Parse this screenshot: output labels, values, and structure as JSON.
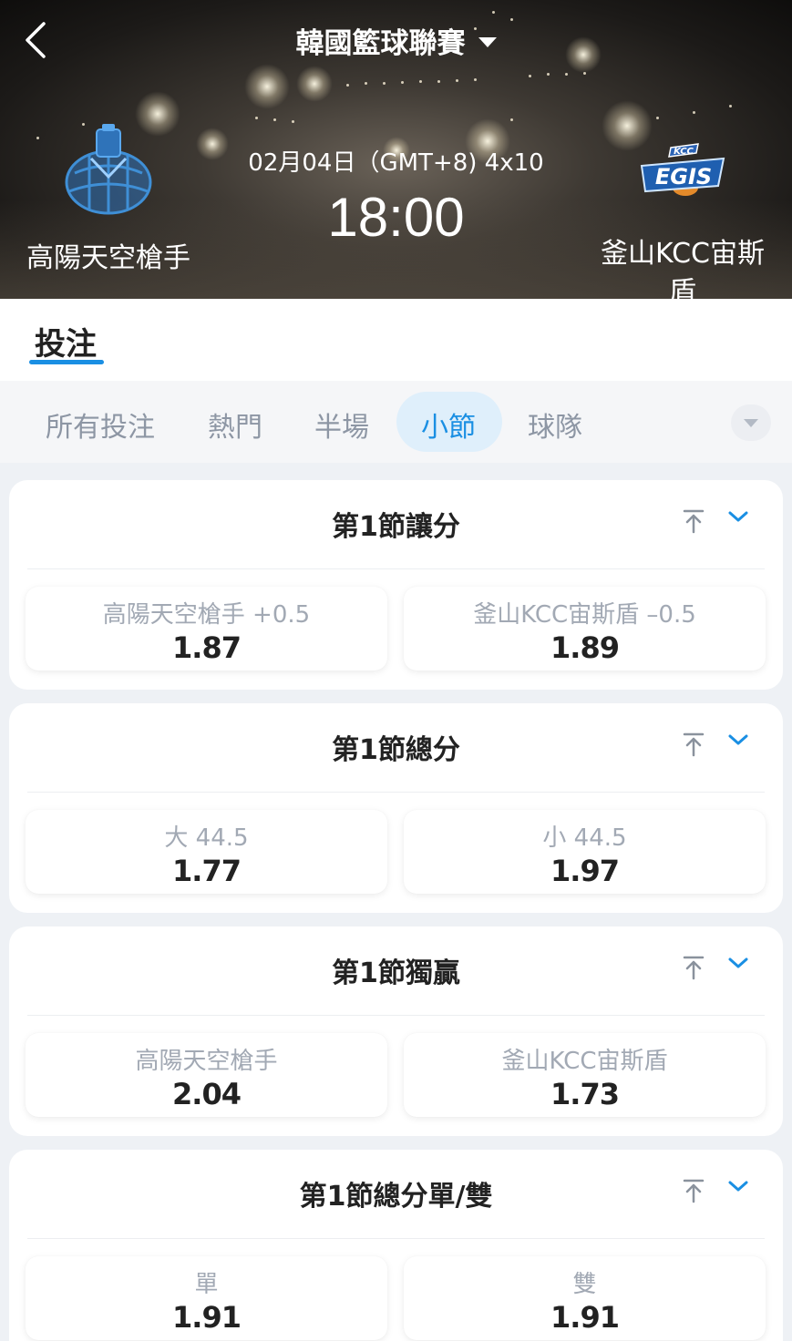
{
  "header": {
    "league_title": "韓國籃球聯賽",
    "match_date": "02月04日（GMT+8) 4x10",
    "match_time": "18:00",
    "home_team": "高陽天空槍手",
    "away_team": "釜山KCC宙斯盾",
    "away_logo_text": "EGIS",
    "away_logo_badge": "KCC"
  },
  "tabs": {
    "bet_label": "投注"
  },
  "filters": {
    "items": [
      "所有投注",
      "熱門",
      "半場",
      "小節",
      "球隊"
    ],
    "active": "小節"
  },
  "markets": [
    {
      "title": "第1節讓分",
      "left": {
        "label": "高陽天空槍手 +0.5",
        "price": "1.87"
      },
      "right": {
        "label": "釜山KCC宙斯盾 –0.5",
        "price": "1.89"
      }
    },
    {
      "title": "第1節總分",
      "left": {
        "label": "大 44.5",
        "price": "1.77"
      },
      "right": {
        "label": "小 44.5",
        "price": "1.97"
      }
    },
    {
      "title": "第1節獨贏",
      "left": {
        "label": "高陽天空槍手",
        "price": "2.04"
      },
      "right": {
        "label": "釜山KCC宙斯盾",
        "price": "1.73"
      }
    },
    {
      "title": "第1節總分單/雙",
      "left": {
        "label": "單",
        "price": "1.91"
      },
      "right": {
        "label": "雙",
        "price": "1.91"
      }
    }
  ],
  "colors": {
    "accent": "#1a8fe3",
    "muted_text": "#a2a9b4",
    "background": "#eef1f5"
  }
}
